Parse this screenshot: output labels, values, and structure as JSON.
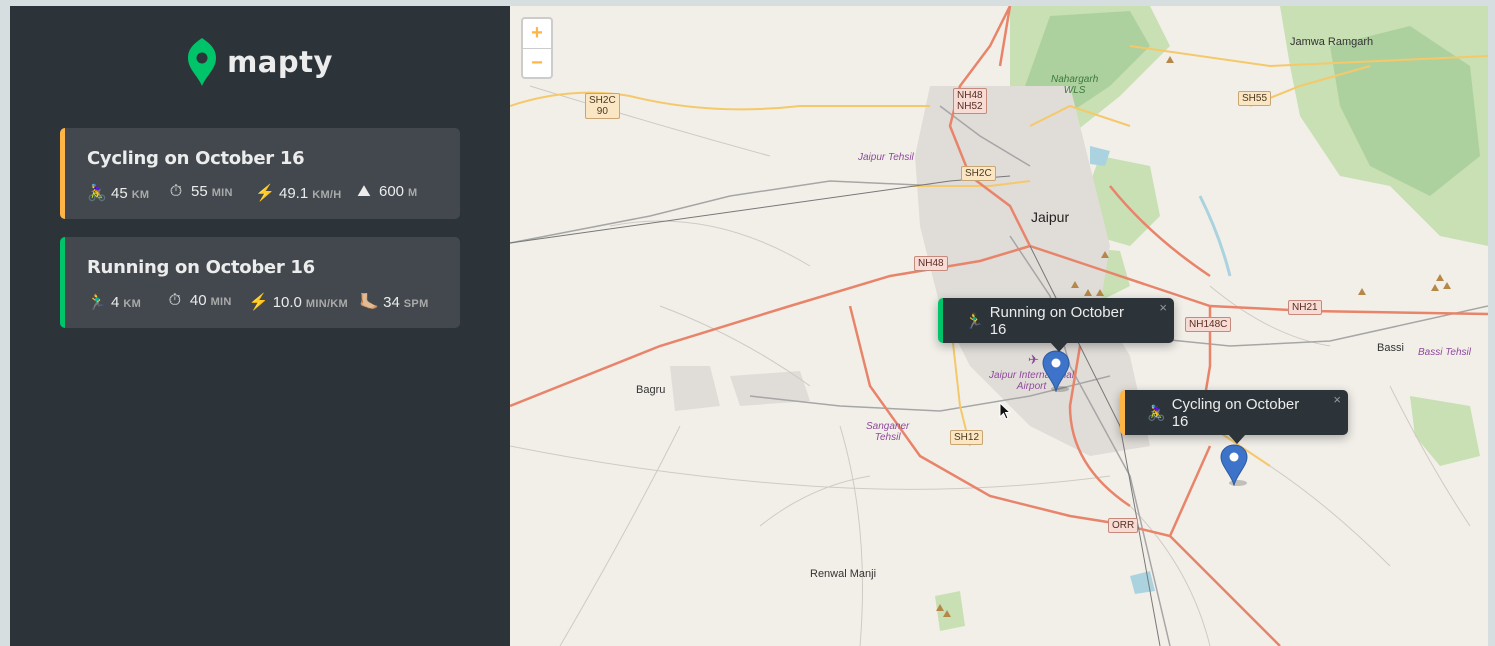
{
  "app": {
    "name": "mapty"
  },
  "colors": {
    "cycling": "#ffb545",
    "running": "#00c46a",
    "sidebar": "#2d3439",
    "card": "#42484d"
  },
  "workouts": [
    {
      "type": "cycling",
      "title": "Cycling on October 16",
      "stats": [
        {
          "icon": "🚴‍♀️",
          "icon_name": "cycling-icon",
          "value": "45",
          "unit": "km"
        },
        {
          "icon": "⏱",
          "icon_name": "stopwatch-icon",
          "value": "55",
          "unit": "min"
        },
        {
          "icon": "⚡️",
          "icon_name": "lightning-icon",
          "value": "49.1",
          "unit": "km/h"
        },
        {
          "icon": "⛰",
          "icon_name": "mountain-icon",
          "value": "600",
          "unit": "m"
        }
      ]
    },
    {
      "type": "running",
      "title": "Running on October 16",
      "stats": [
        {
          "icon": "🏃‍♂️",
          "icon_name": "running-icon",
          "value": "4",
          "unit": "km"
        },
        {
          "icon": "⏱",
          "icon_name": "stopwatch-icon",
          "value": "40",
          "unit": "min"
        },
        {
          "icon": "⚡️",
          "icon_name": "lightning-icon",
          "value": "10.0",
          "unit": "min/km"
        },
        {
          "icon": "🦶🏼",
          "icon_name": "foot-icon",
          "value": "34",
          "unit": "spm"
        }
      ]
    }
  ],
  "map": {
    "zoom_in": "+",
    "zoom_out": "−",
    "popups": [
      {
        "type": "running",
        "icon": "🏃‍♂️",
        "text": "Running on October 16",
        "close": "×"
      },
      {
        "type": "cycling",
        "icon": "🚴‍♀️",
        "text": "Cycling on October 16",
        "close": "×"
      }
    ],
    "places": {
      "jaipur": "Jaipur",
      "bagru": "Bagru",
      "bassi": "Bassi",
      "renwal": "Renwal Manji",
      "jamwa": "Jamwa Ramgarh",
      "jaipur_tehsil": "Jaipur Tehsil",
      "sanganer_tehsil_1": "Sanganer",
      "sanganer_tehsil_2": "Tehsil",
      "bassi_tehsil": "Bassi Tehsil",
      "airport_1": "Jaipur International",
      "airport_2": "Airport",
      "nahargarh_1": "Nahargarh",
      "nahargarh_2": "WLS"
    },
    "shields": {
      "sh2c90_1": "SH2C",
      "sh2c90_2": "90",
      "nh48nh52_1": "NH48",
      "nh48nh52_2": "NH52",
      "sh2c": "SH2C",
      "nh48": "NH48",
      "sh55": "SH55",
      "nh21": "NH21",
      "nh148c": "NH148C",
      "sh12": "SH12",
      "orr": "ORR"
    }
  }
}
